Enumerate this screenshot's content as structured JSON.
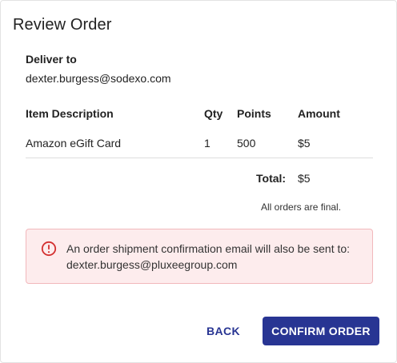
{
  "dialog": {
    "title": "Review Order",
    "deliver_label": "Deliver to",
    "deliver_email": "dexter.burgess@sodexo.com"
  },
  "table": {
    "headers": {
      "description": "Item Description",
      "qty": "Qty",
      "points": "Points",
      "amount": "Amount"
    },
    "rows": [
      {
        "description": "Amazon eGift Card",
        "qty": "1",
        "points": "500",
        "amount": "$5"
      }
    ]
  },
  "summary": {
    "total_label": "Total:",
    "total_value": "$5",
    "final_note": "All orders are final."
  },
  "alert": {
    "icon": "alert-circle-icon",
    "text": "An order shipment confirmation email will also be sent to: dexter.burgess@pluxeegroup.com",
    "color": "#d32f2f",
    "background": "#fdeced"
  },
  "actions": {
    "back_label": "BACK",
    "confirm_label": "CONFIRM ORDER",
    "primary_color": "#283593"
  }
}
